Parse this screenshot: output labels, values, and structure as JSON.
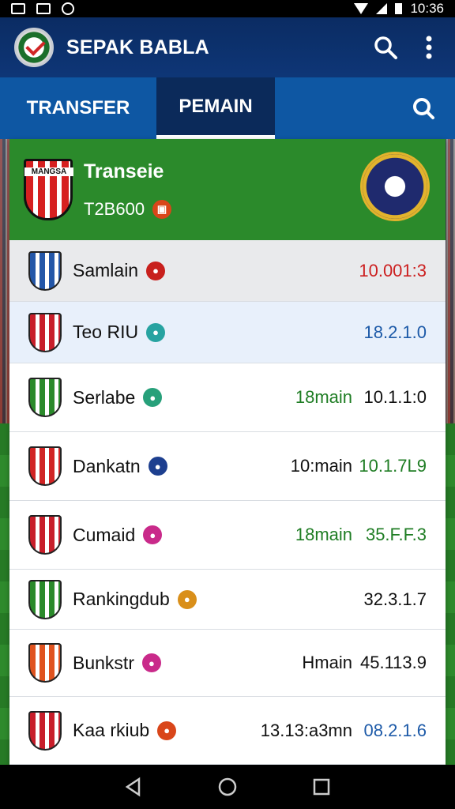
{
  "status_bar": {
    "time": "10:36"
  },
  "app": {
    "title": "SEPAK BABLA"
  },
  "tabs": [
    {
      "label": "TRANSFER"
    },
    {
      "label": "PEMAIN"
    }
  ],
  "header": {
    "crest_label": "MANGSA",
    "title": "Transeie",
    "subtitle": "T2B600"
  },
  "rows": [
    {
      "name": "Samlain",
      "tag_color": "#c8201d",
      "status": "",
      "status_color": "#111111",
      "value": "10.001:3",
      "value_color": "#cc1f1f",
      "bg": "#e9eaec",
      "crest": "#2457a8"
    },
    {
      "name": "Teo RIU",
      "tag_color": "#27a3a1",
      "status": "",
      "status_color": "#111111",
      "value": "18.2.1.0",
      "value_color": "#1d5aa8",
      "bg": "#e8f0fb",
      "crest": "#c81e2a"
    },
    {
      "name": "Serlabe",
      "tag_color": "#27a07a",
      "status": "18main",
      "status_color": "#1f7d24",
      "value": "10.1.1:0",
      "value_color": "#111111",
      "bg": "#ffffff",
      "crest": "#2b8a2b"
    },
    {
      "name": "Dankatn",
      "tag_color": "#1d3f8f",
      "status": "10:main",
      "status_color": "#111111",
      "value": "10.1.7L9",
      "value_color": "#1f7d24",
      "bg": "#ffffff",
      "crest": "#d12424"
    },
    {
      "name": "Cumaid",
      "tag_color": "#c92a8a",
      "status": "18main",
      "status_color": "#1f7d24",
      "value": "35.F.F.3",
      "value_color": "#1f7d24",
      "bg": "#ffffff",
      "crest": "#c81e2a"
    },
    {
      "name": "Rankingdub",
      "tag_color": "#d98f1a",
      "status": "",
      "status_color": "#111111",
      "value": "32.3.1.7",
      "value_color": "#111111",
      "bg": "#ffffff",
      "crest": "#2b8a2b"
    },
    {
      "name": "Bunkstr",
      "tag_color": "#c92a8a",
      "status": "Hmain",
      "status_color": "#111111",
      "value": "45.113.9",
      "value_color": "#111111",
      "bg": "#ffffff",
      "crest": "#e0531f"
    },
    {
      "name": "Kaa rkiub",
      "tag_color": "#d9461a",
      "status": "13.13:a3mn",
      "status_color": "#111111",
      "value": "08.2.1.6",
      "value_color": "#1d5aa8",
      "bg": "#ffffff",
      "crest": "#c81e2a"
    }
  ]
}
